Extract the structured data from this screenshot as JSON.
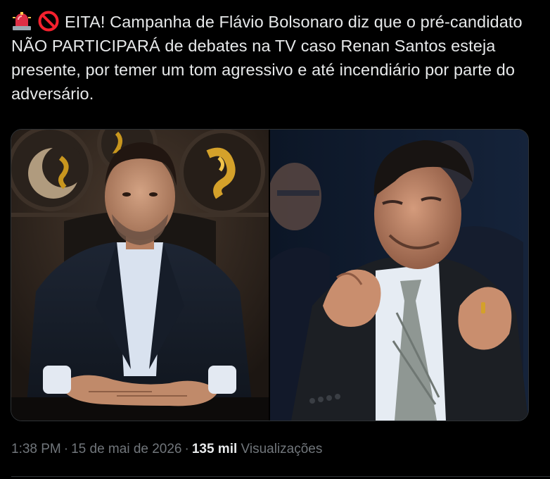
{
  "tweet": {
    "emojis": [
      "rotating-light-icon",
      "no-entry-icon"
    ],
    "text": "EITA! Campanha de Flávio Bolsonaro diz que o pré-candidato NÃO PARTICIPARÁ de debates na TV caso Renan Santos esteja presente, por temer um tom agressivo e até incendiário por parte do adversário."
  },
  "media": {
    "photos": [
      {
        "subject": "man in dark suit seated at desk, hands clasped, gold ornaments in background"
      },
      {
        "subject": "man adjusting tie and collar in a dark suit, people in background"
      }
    ]
  },
  "meta": {
    "time": "1:38 PM",
    "date": "15 de mai de 2026",
    "views_count": "135 mil",
    "views_label": "Visualizações"
  },
  "colors": {
    "background": "#000000",
    "text": "#e7e9ea",
    "secondary": "#71767b",
    "border": "#2f3336"
  }
}
